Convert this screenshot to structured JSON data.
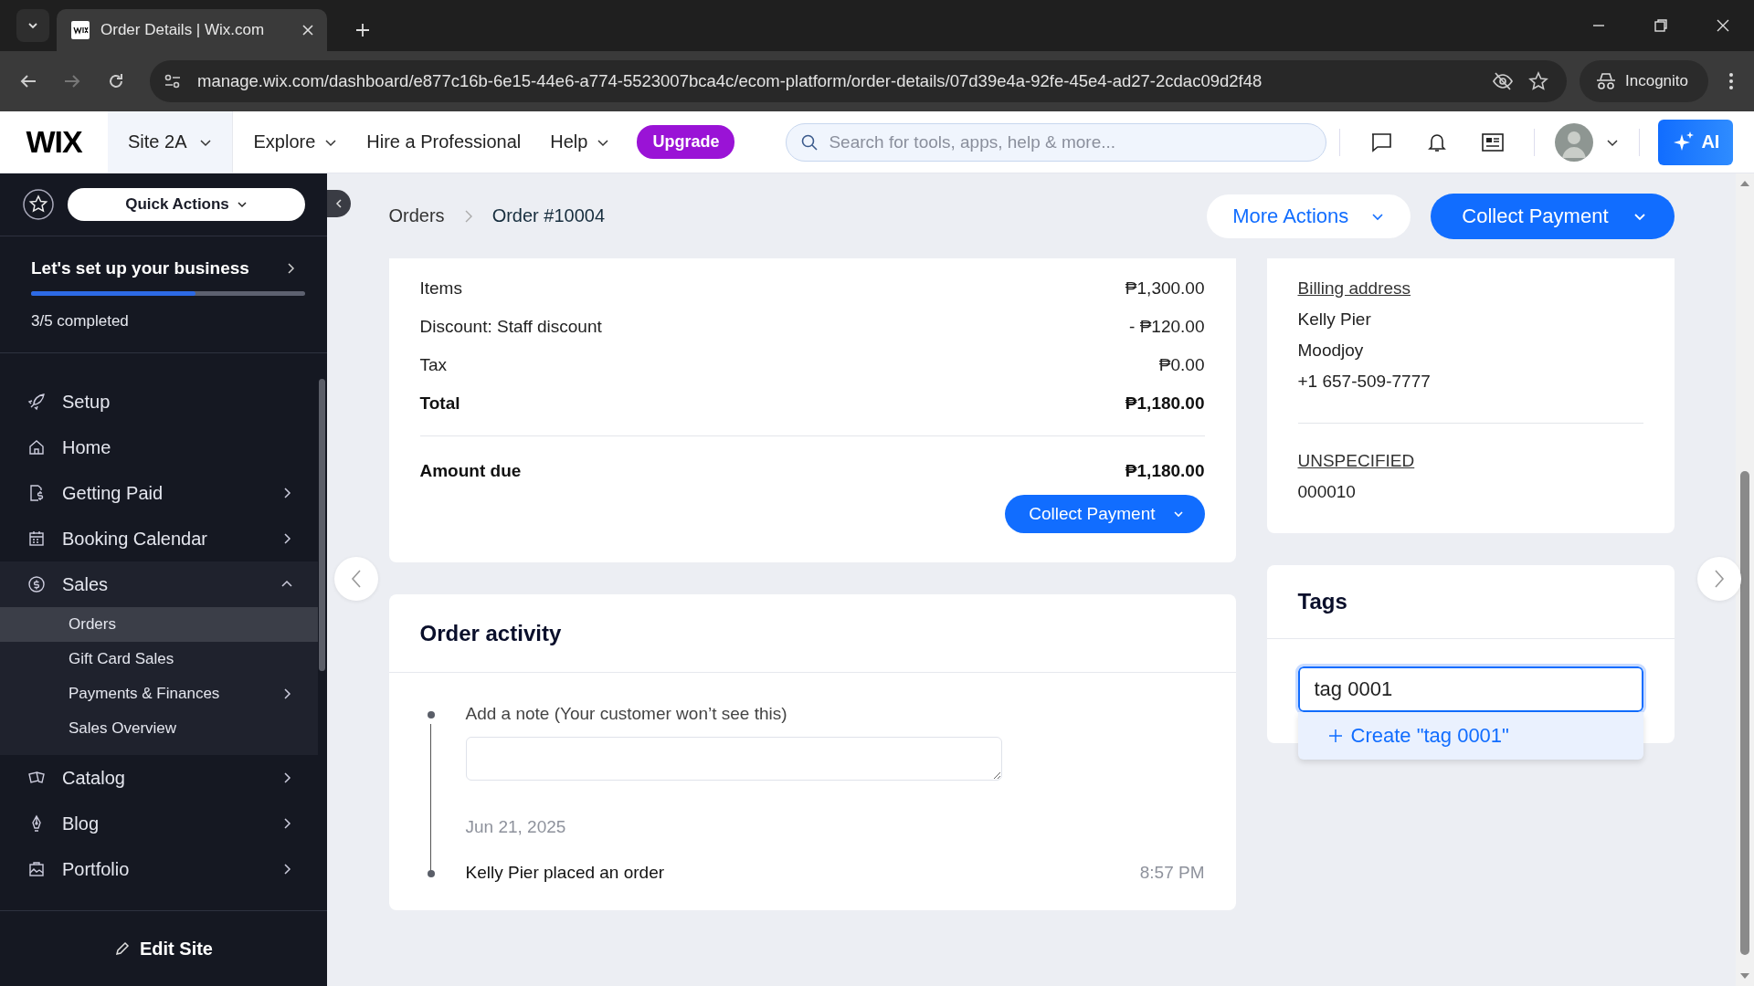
{
  "browser": {
    "tab_title": "Order Details | Wix.com",
    "url": "manage.wix.com/dashboard/e877c16b-6e15-44e6-a774-5523007bca4c/ecom-platform/order-details/07d39e4a-92fe-45e4-ad27-2cdac09d2f48",
    "profile": "Incognito"
  },
  "topbar": {
    "logo": "WIX",
    "site": "Site 2A",
    "nav": [
      {
        "label": "Explore",
        "dropdown": true
      },
      {
        "label": "Hire a Professional",
        "dropdown": false
      },
      {
        "label": "Help",
        "dropdown": true
      }
    ],
    "upgrade": "Upgrade",
    "search": {
      "placeholder": "Search for tools, apps, help & more..."
    },
    "ai": "AI"
  },
  "sidebar": {
    "quick_actions": "Quick Actions",
    "setup": {
      "title": "Let's set up your business",
      "level": 0.6,
      "progress": "3/5 completed"
    },
    "items": [
      {
        "label": "Setup",
        "arrow": false
      },
      {
        "label": "Home",
        "arrow": false
      },
      {
        "label": "Getting Paid",
        "arrow": true,
        "expanded": false
      },
      {
        "label": "Booking Calendar",
        "arrow": true,
        "expanded": false
      },
      {
        "label": "Sales",
        "arrow": true,
        "expanded": true,
        "children": [
          {
            "label": "Orders",
            "selected": true,
            "arrow": false
          },
          {
            "label": "Gift Card Sales",
            "selected": false,
            "arrow": false
          },
          {
            "label": "Payments & Finances",
            "selected": false,
            "arrow": true
          },
          {
            "label": "Sales Overview",
            "selected": false,
            "arrow": false
          }
        ]
      },
      {
        "label": "Catalog",
        "arrow": true,
        "expanded": false
      },
      {
        "label": "Blog",
        "arrow": true,
        "expanded": false
      },
      {
        "label": "Portfolio",
        "arrow": true,
        "expanded": false
      }
    ],
    "edit_site": "Edit Site"
  },
  "breadcrumb": [
    "Orders",
    "Order #10004"
  ],
  "actions": {
    "more": "More Actions",
    "collect": "Collect Payment"
  },
  "summary": {
    "rows": [
      {
        "label": "Items",
        "value": "₱1,300.00",
        "bold": false
      },
      {
        "label": "Discount: Staff discount",
        "value": "- ₱120.00",
        "bold": false
      },
      {
        "label": "Tax",
        "value": "₱0.00",
        "bold": false
      },
      {
        "label": "Total",
        "value": "₱1,180.00",
        "bold": true
      }
    ],
    "amount_due": {
      "label": "Amount due",
      "value": "₱1,180.00"
    },
    "button": "Collect Payment"
  },
  "activity": {
    "title": "Order activity",
    "note_label": "Add a note (Your customer won’t see this)",
    "date": "Jun 21, 2025",
    "events": [
      {
        "text": "Kelly Pier placed an order",
        "time": "8:57 PM"
      }
    ]
  },
  "billing": {
    "heading": "Billing address",
    "lines": [
      "Kelly Pier",
      "Moodjoy",
      "+1 657-509-7777"
    ],
    "extra_heading": "UNSPECIFIED",
    "extra_value": "000010"
  },
  "tags": {
    "title": "Tags",
    "input": {
      "value": "tag 0001"
    },
    "suggestion": "Create \"tag 0001\""
  }
}
